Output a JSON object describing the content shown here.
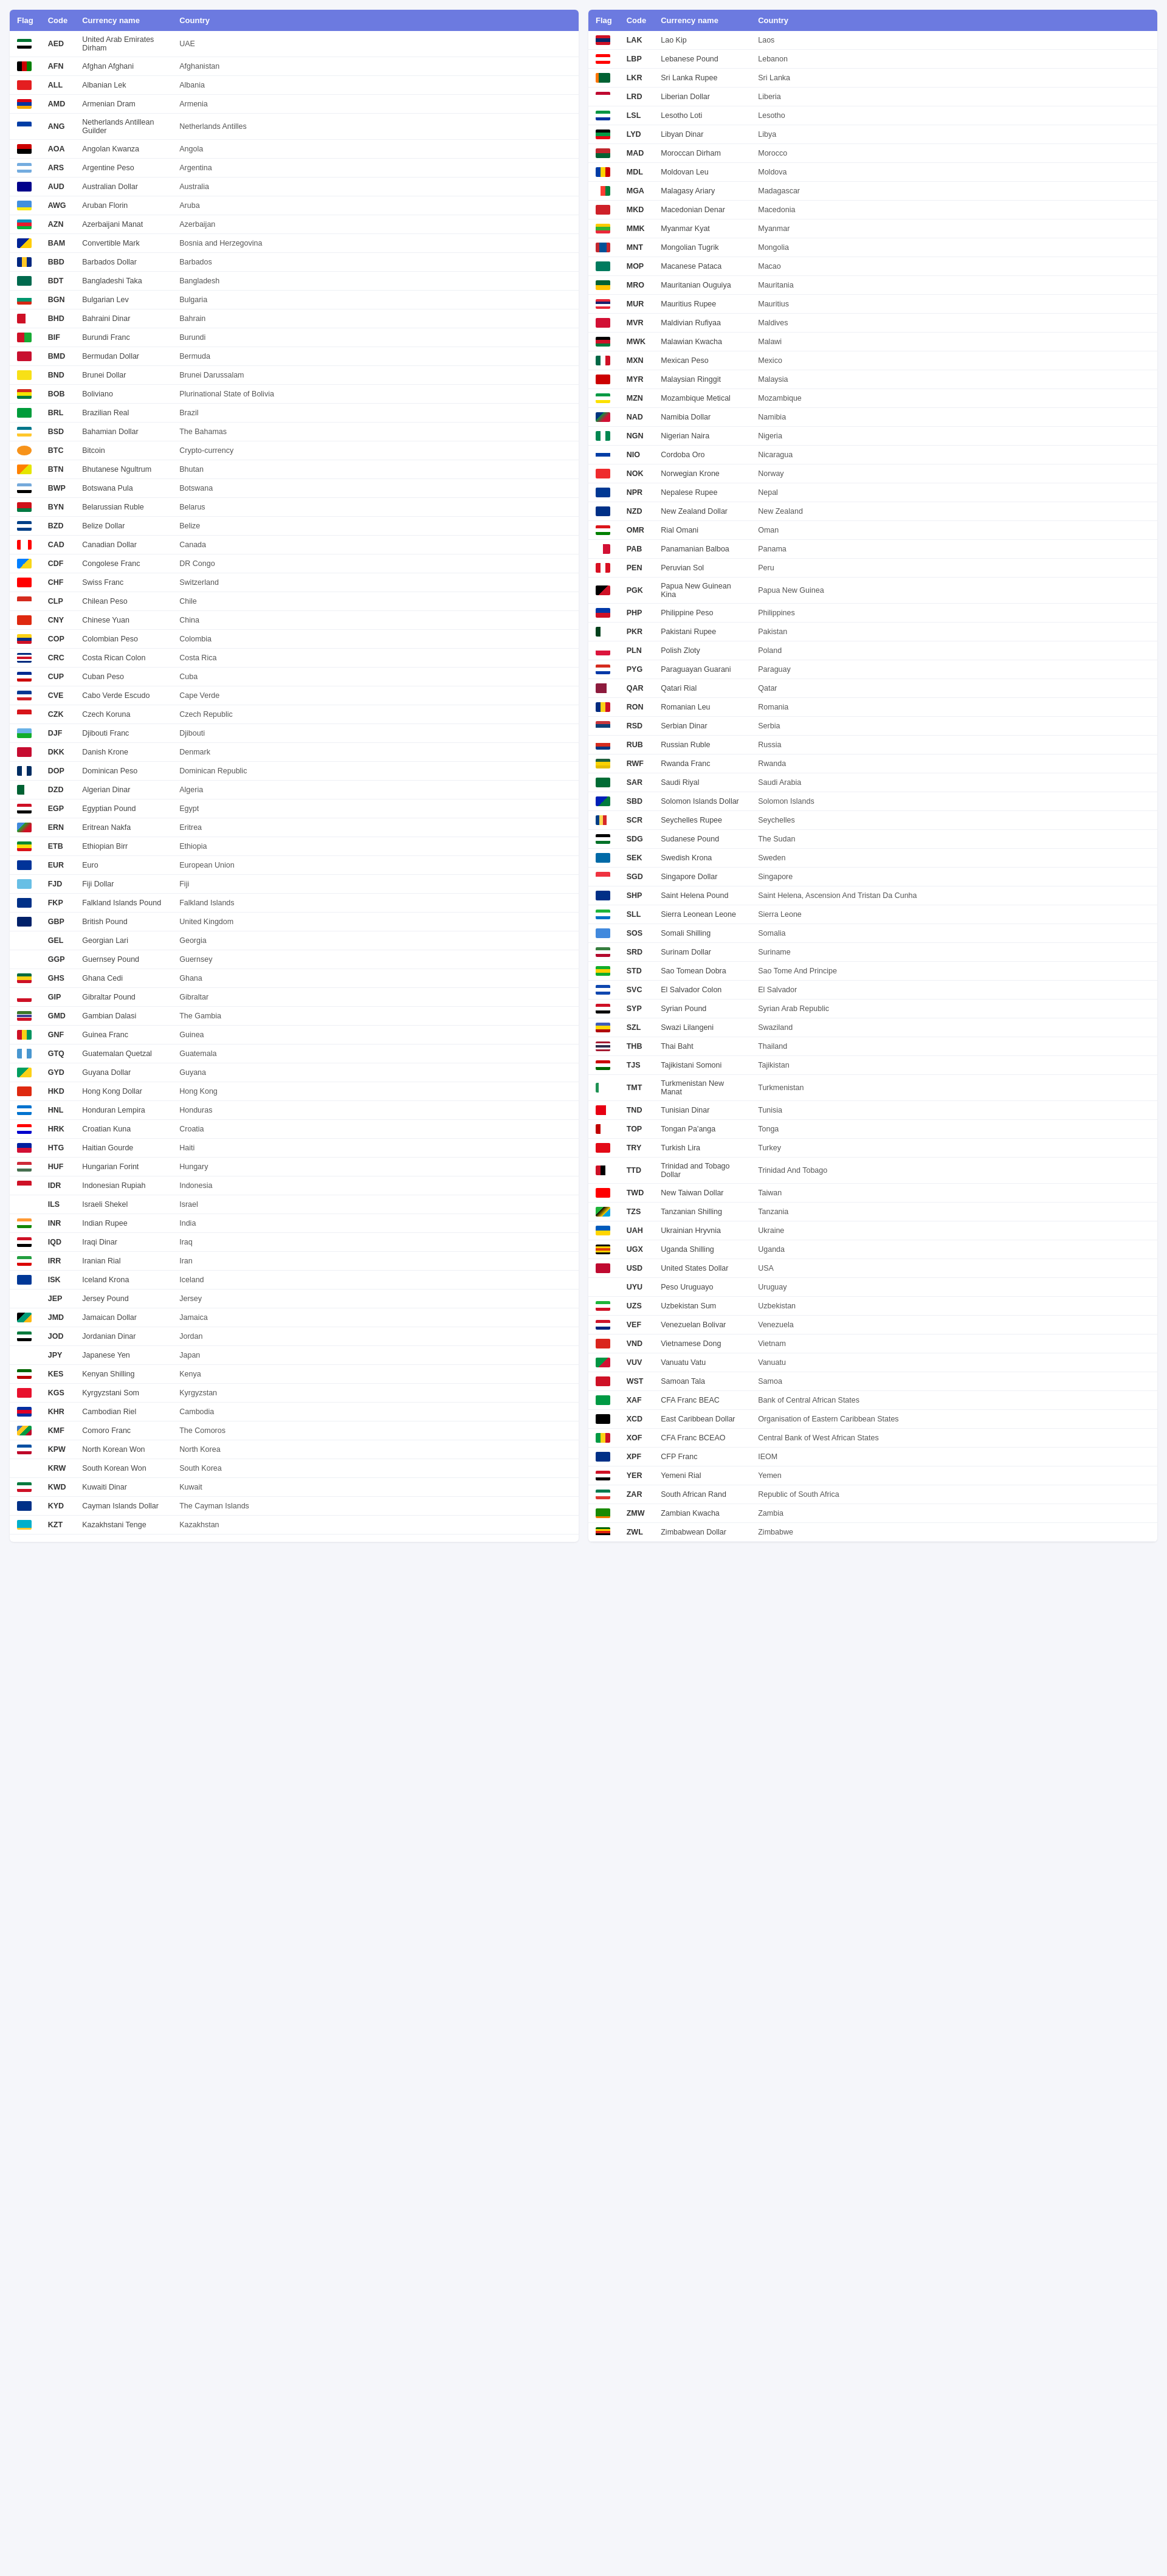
{
  "header": {
    "flag": "Flag",
    "code": "Code",
    "currency_name": "Currency name",
    "country": "Country"
  },
  "left_table": [
    {
      "code": "AED",
      "name": "United Arab Emirates Dirham",
      "country": "UAE",
      "flag": "ae"
    },
    {
      "code": "AFN",
      "name": "Afghan Afghani",
      "country": "Afghanistan",
      "flag": "af"
    },
    {
      "code": "ALL",
      "name": "Albanian Lek",
      "country": "Albania",
      "flag": "al"
    },
    {
      "code": "AMD",
      "name": "Armenian Dram",
      "country": "Armenia",
      "flag": "am"
    },
    {
      "code": "ANG",
      "name": "Netherlands Antillean Guilder",
      "country": "Netherlands Antilles",
      "flag": "an"
    },
    {
      "code": "AOA",
      "name": "Angolan Kwanza",
      "country": "Angola",
      "flag": "ao"
    },
    {
      "code": "ARS",
      "name": "Argentine Peso",
      "country": "Argentina",
      "flag": "ar"
    },
    {
      "code": "AUD",
      "name": "Australian Dollar",
      "country": "Australia",
      "flag": "au"
    },
    {
      "code": "AWG",
      "name": "Aruban Florin",
      "country": "Aruba",
      "flag": "aw"
    },
    {
      "code": "AZN",
      "name": "Azerbaijani Manat",
      "country": "Azerbaijan",
      "flag": "az"
    },
    {
      "code": "BAM",
      "name": "Convertible Mark",
      "country": "Bosnia and Herzegovina",
      "flag": "ba"
    },
    {
      "code": "BBD",
      "name": "Barbados Dollar",
      "country": "Barbados",
      "flag": "bb"
    },
    {
      "code": "BDT",
      "name": "Bangladeshi Taka",
      "country": "Bangladesh",
      "flag": "bd"
    },
    {
      "code": "BGN",
      "name": "Bulgarian Lev",
      "country": "Bulgaria",
      "flag": "bg"
    },
    {
      "code": "BHD",
      "name": "Bahraini Dinar",
      "country": "Bahrain",
      "flag": "bh"
    },
    {
      "code": "BIF",
      "name": "Burundi Franc",
      "country": "Burundi",
      "flag": "bi"
    },
    {
      "code": "BMD",
      "name": "Bermudan Dollar",
      "country": "Bermuda",
      "flag": "bm"
    },
    {
      "code": "BND",
      "name": "Brunei Dollar",
      "country": "Brunei Darussalam",
      "flag": "bn"
    },
    {
      "code": "BOB",
      "name": "Boliviano",
      "country": "Plurinational State of Bolivia",
      "flag": "bo"
    },
    {
      "code": "BRL",
      "name": "Brazilian Real",
      "country": "Brazil",
      "flag": "br"
    },
    {
      "code": "BSD",
      "name": "Bahamian Dollar",
      "country": "The Bahamas",
      "flag": "bs"
    },
    {
      "code": "BTC",
      "name": "Bitcoin",
      "country": "Crypto-currency",
      "flag": "btc"
    },
    {
      "code": "BTN",
      "name": "Bhutanese Ngultrum",
      "country": "Bhutan",
      "flag": "bt"
    },
    {
      "code": "BWP",
      "name": "Botswana Pula",
      "country": "Botswana",
      "flag": "bw"
    },
    {
      "code": "BYN",
      "name": "Belarussian Ruble",
      "country": "Belarus",
      "flag": "by"
    },
    {
      "code": "BZD",
      "name": "Belize Dollar",
      "country": "Belize",
      "flag": "bz"
    },
    {
      "code": "CAD",
      "name": "Canadian Dollar",
      "country": "Canada",
      "flag": "ca"
    },
    {
      "code": "CDF",
      "name": "Congolese Franc",
      "country": "DR Congo",
      "flag": "cd"
    },
    {
      "code": "CHF",
      "name": "Swiss Franc",
      "country": "Switzerland",
      "flag": "ch"
    },
    {
      "code": "CLP",
      "name": "Chilean Peso",
      "country": "Chile",
      "flag": "cl"
    },
    {
      "code": "CNY",
      "name": "Chinese Yuan",
      "country": "China",
      "flag": "cn"
    },
    {
      "code": "COP",
      "name": "Colombian Peso",
      "country": "Colombia",
      "flag": "co"
    },
    {
      "code": "CRC",
      "name": "Costa Rican Colon",
      "country": "Costa Rica",
      "flag": "cr"
    },
    {
      "code": "CUP",
      "name": "Cuban Peso",
      "country": "Cuba",
      "flag": "cu"
    },
    {
      "code": "CVE",
      "name": "Cabo Verde Escudo",
      "country": "Cape Verde",
      "flag": "cv"
    },
    {
      "code": "CZK",
      "name": "Czech Koruna",
      "country": "Czech Republic",
      "flag": "cz"
    },
    {
      "code": "DJF",
      "name": "Djibouti Franc",
      "country": "Djibouti",
      "flag": "dj"
    },
    {
      "code": "DKK",
      "name": "Danish Krone",
      "country": "Denmark",
      "flag": "dk"
    },
    {
      "code": "DOP",
      "name": "Dominican Peso",
      "country": "Dominican Republic",
      "flag": "do"
    },
    {
      "code": "DZD",
      "name": "Algerian Dinar",
      "country": "Algeria",
      "flag": "dz"
    },
    {
      "code": "EGP",
      "name": "Egyptian Pound",
      "country": "Egypt",
      "flag": "eg"
    },
    {
      "code": "ERN",
      "name": "Eritrean Nakfa",
      "country": "Eritrea",
      "flag": "er"
    },
    {
      "code": "ETB",
      "name": "Ethiopian Birr",
      "country": "Ethiopia",
      "flag": "et"
    },
    {
      "code": "EUR",
      "name": "Euro",
      "country": "European Union",
      "flag": "eu"
    },
    {
      "code": "FJD",
      "name": "Fiji Dollar",
      "country": "Fiji",
      "flag": "fj"
    },
    {
      "code": "FKP",
      "name": "Falkland Islands Pound",
      "country": "Falkland Islands",
      "flag": "fk"
    },
    {
      "code": "GBP",
      "name": "British Pound",
      "country": "United Kingdom",
      "flag": "gb"
    },
    {
      "code": "GEL",
      "name": "Georgian Lari",
      "country": "Georgia",
      "flag": "ge"
    },
    {
      "code": "GGP",
      "name": "Guernsey Pound",
      "country": "Guernsey",
      "flag": "gg"
    },
    {
      "code": "GHS",
      "name": "Ghana Cedi",
      "country": "Ghana",
      "flag": "gh"
    },
    {
      "code": "GIP",
      "name": "Gibraltar Pound",
      "country": "Gibraltar",
      "flag": "gi"
    },
    {
      "code": "GMD",
      "name": "Gambian Dalasi",
      "country": "The Gambia",
      "flag": "gm"
    },
    {
      "code": "GNF",
      "name": "Guinea Franc",
      "country": "Guinea",
      "flag": "gn"
    },
    {
      "code": "GTQ",
      "name": "Guatemalan Quetzal",
      "country": "Guatemala",
      "flag": "gt"
    },
    {
      "code": "GYD",
      "name": "Guyana Dollar",
      "country": "Guyana",
      "flag": "gy"
    },
    {
      "code": "HKD",
      "name": "Hong Kong Dollar",
      "country": "Hong Kong",
      "flag": "hk"
    },
    {
      "code": "HNL",
      "name": "Honduran Lempira",
      "country": "Honduras",
      "flag": "hn"
    },
    {
      "code": "HRK",
      "name": "Croatian Kuna",
      "country": "Croatia",
      "flag": "hr"
    },
    {
      "code": "HTG",
      "name": "Haitian Gourde",
      "country": "Haiti",
      "flag": "ht"
    },
    {
      "code": "HUF",
      "name": "Hungarian Forint",
      "country": "Hungary",
      "flag": "hu"
    },
    {
      "code": "IDR",
      "name": "Indonesian Rupiah",
      "country": "Indonesia",
      "flag": "id"
    },
    {
      "code": "ILS",
      "name": "Israeli Shekel",
      "country": "Israel",
      "flag": "il"
    },
    {
      "code": "INR",
      "name": "Indian Rupee",
      "country": "India",
      "flag": "in"
    },
    {
      "code": "IQD",
      "name": "Iraqi Dinar",
      "country": "Iraq",
      "flag": "iq"
    },
    {
      "code": "IRR",
      "name": "Iranian Rial",
      "country": "Iran",
      "flag": "ir"
    },
    {
      "code": "ISK",
      "name": "Iceland Krona",
      "country": "Iceland",
      "flag": "is"
    },
    {
      "code": "JEP",
      "name": "Jersey Pound",
      "country": "Jersey",
      "flag": "je"
    },
    {
      "code": "JMD",
      "name": "Jamaican Dollar",
      "country": "Jamaica",
      "flag": "jm"
    },
    {
      "code": "JOD",
      "name": "Jordanian Dinar",
      "country": "Jordan",
      "flag": "jo"
    },
    {
      "code": "JPY",
      "name": "Japanese Yen",
      "country": "Japan",
      "flag": "jp"
    },
    {
      "code": "KES",
      "name": "Kenyan Shilling",
      "country": "Kenya",
      "flag": "ke"
    },
    {
      "code": "KGS",
      "name": "Kyrgyzstani Som",
      "country": "Kyrgyzstan",
      "flag": "kg"
    },
    {
      "code": "KHR",
      "name": "Cambodian Riel",
      "country": "Cambodia",
      "flag": "kh"
    },
    {
      "code": "KMF",
      "name": "Comoro Franc",
      "country": "The Comoros",
      "flag": "km"
    },
    {
      "code": "KPW",
      "name": "North Korean Won",
      "country": "North Korea",
      "flag": "kp"
    },
    {
      "code": "KRW",
      "name": "South Korean Won",
      "country": "South Korea",
      "flag": "kr"
    },
    {
      "code": "KWD",
      "name": "Kuwaiti Dinar",
      "country": "Kuwait",
      "flag": "kw"
    },
    {
      "code": "KYD",
      "name": "Cayman Islands Dollar",
      "country": "The Cayman Islands",
      "flag": "ky"
    },
    {
      "code": "KZT",
      "name": "Kazakhstani Tenge",
      "country": "Kazakhstan",
      "flag": "kz"
    }
  ],
  "right_table": [
    {
      "code": "LAK",
      "name": "Lao Kip",
      "country": "Laos",
      "flag": "la"
    },
    {
      "code": "LBP",
      "name": "Lebanese Pound",
      "country": "Lebanon",
      "flag": "lb"
    },
    {
      "code": "LKR",
      "name": "Sri Lanka Rupee",
      "country": "Sri Lanka",
      "flag": "lk"
    },
    {
      "code": "LRD",
      "name": "Liberian Dollar",
      "country": "Liberia",
      "flag": "lr"
    },
    {
      "code": "LSL",
      "name": "Lesotho Loti",
      "country": "Lesotho",
      "flag": "ls"
    },
    {
      "code": "LYD",
      "name": "Libyan Dinar",
      "country": "Libya",
      "flag": "ly"
    },
    {
      "code": "MAD",
      "name": "Moroccan Dirham",
      "country": "Morocco",
      "flag": "ma"
    },
    {
      "code": "MDL",
      "name": "Moldovan Leu",
      "country": "Moldova",
      "flag": "md"
    },
    {
      "code": "MGA",
      "name": "Malagasy Ariary",
      "country": "Madagascar",
      "flag": "mg"
    },
    {
      "code": "MKD",
      "name": "Macedonian Denar",
      "country": "Macedonia",
      "flag": "mk"
    },
    {
      "code": "MMK",
      "name": "Myanmar Kyat",
      "country": "Myanmar",
      "flag": "mm"
    },
    {
      "code": "MNT",
      "name": "Mongolian Tugrik",
      "country": "Mongolia",
      "flag": "mn"
    },
    {
      "code": "MOP",
      "name": "Macanese Pataca",
      "country": "Macao",
      "flag": "mo"
    },
    {
      "code": "MRO",
      "name": "Mauritanian Ouguiya",
      "country": "Mauritania",
      "flag": "mr"
    },
    {
      "code": "MUR",
      "name": "Mauritius Rupee",
      "country": "Mauritius",
      "flag": "mu"
    },
    {
      "code": "MVR",
      "name": "Maldivian Rufiyaa",
      "country": "Maldives",
      "flag": "mv"
    },
    {
      "code": "MWK",
      "name": "Malawian Kwacha",
      "country": "Malawi",
      "flag": "mw"
    },
    {
      "code": "MXN",
      "name": "Mexican Peso",
      "country": "Mexico",
      "flag": "mx"
    },
    {
      "code": "MYR",
      "name": "Malaysian Ringgit",
      "country": "Malaysia",
      "flag": "my"
    },
    {
      "code": "MZN",
      "name": "Mozambique Metical",
      "country": "Mozambique",
      "flag": "mz"
    },
    {
      "code": "NAD",
      "name": "Namibia Dollar",
      "country": "Namibia",
      "flag": "na"
    },
    {
      "code": "NGN",
      "name": "Nigerian Naira",
      "country": "Nigeria",
      "flag": "ng"
    },
    {
      "code": "NIO",
      "name": "Cordoba Oro",
      "country": "Nicaragua",
      "flag": "ni"
    },
    {
      "code": "NOK",
      "name": "Norwegian Krone",
      "country": "Norway",
      "flag": "no"
    },
    {
      "code": "NPR",
      "name": "Nepalese Rupee",
      "country": "Nepal",
      "flag": "np"
    },
    {
      "code": "NZD",
      "name": "New Zealand Dollar",
      "country": "New Zealand",
      "flag": "nz"
    },
    {
      "code": "OMR",
      "name": "Rial Omani",
      "country": "Oman",
      "flag": "om"
    },
    {
      "code": "PAB",
      "name": "Panamanian Balboa",
      "country": "Panama",
      "flag": "pa"
    },
    {
      "code": "PEN",
      "name": "Peruvian Sol",
      "country": "Peru",
      "flag": "pe"
    },
    {
      "code": "PGK",
      "name": "Papua New Guinean Kina",
      "country": "Papua New Guinea",
      "flag": "pg"
    },
    {
      "code": "PHP",
      "name": "Philippine Peso",
      "country": "Philippines",
      "flag": "ph"
    },
    {
      "code": "PKR",
      "name": "Pakistani Rupee",
      "country": "Pakistan",
      "flag": "pk"
    },
    {
      "code": "PLN",
      "name": "Polish Zloty",
      "country": "Poland",
      "flag": "pl"
    },
    {
      "code": "PYG",
      "name": "Paraguayan Guarani",
      "country": "Paraguay",
      "flag": "py"
    },
    {
      "code": "QAR",
      "name": "Qatari Rial",
      "country": "Qatar",
      "flag": "qa"
    },
    {
      "code": "RON",
      "name": "Romanian Leu",
      "country": "Romania",
      "flag": "ro"
    },
    {
      "code": "RSD",
      "name": "Serbian Dinar",
      "country": "Serbia",
      "flag": "rs"
    },
    {
      "code": "RUB",
      "name": "Russian Ruble",
      "country": "Russia",
      "flag": "ru"
    },
    {
      "code": "RWF",
      "name": "Rwanda Franc",
      "country": "Rwanda",
      "flag": "rw"
    },
    {
      "code": "SAR",
      "name": "Saudi Riyal",
      "country": "Saudi Arabia",
      "flag": "sa"
    },
    {
      "code": "SBD",
      "name": "Solomon Islands Dollar",
      "country": "Solomon Islands",
      "flag": "sb"
    },
    {
      "code": "SCR",
      "name": "Seychelles Rupee",
      "country": "Seychelles",
      "flag": "sc"
    },
    {
      "code": "SDG",
      "name": "Sudanese Pound",
      "country": "The Sudan",
      "flag": "sd"
    },
    {
      "code": "SEK",
      "name": "Swedish Krona",
      "country": "Sweden",
      "flag": "se"
    },
    {
      "code": "SGD",
      "name": "Singapore Dollar",
      "country": "Singapore",
      "flag": "sg"
    },
    {
      "code": "SHP",
      "name": "Saint Helena Pound",
      "country": "Saint Helena, Ascension And Tristan Da Cunha",
      "flag": "sh"
    },
    {
      "code": "SLL",
      "name": "Sierra Leonean Leone",
      "country": "Sierra Leone",
      "flag": "sl"
    },
    {
      "code": "SOS",
      "name": "Somali Shilling",
      "country": "Somalia",
      "flag": "so"
    },
    {
      "code": "SRD",
      "name": "Surinam Dollar",
      "country": "Suriname",
      "flag": "sr"
    },
    {
      "code": "STD",
      "name": "Sao Tomean Dobra",
      "country": "Sao Tome And Principe",
      "flag": "st"
    },
    {
      "code": "SVC",
      "name": "El Salvador Colon",
      "country": "El Salvador",
      "flag": "sv"
    },
    {
      "code": "SYP",
      "name": "Syrian Pound",
      "country": "Syrian Arab Republic",
      "flag": "sy"
    },
    {
      "code": "SZL",
      "name": "Swazi Lilangeni",
      "country": "Swaziland",
      "flag": "sz"
    },
    {
      "code": "THB",
      "name": "Thai Baht",
      "country": "Thailand",
      "flag": "th"
    },
    {
      "code": "TJS",
      "name": "Tajikistani Somoni",
      "country": "Tajikistan",
      "flag": "tj"
    },
    {
      "code": "TMT",
      "name": "Turkmenistan New Manat",
      "country": "Turkmenistan",
      "flag": "tm"
    },
    {
      "code": "TND",
      "name": "Tunisian Dinar",
      "country": "Tunisia",
      "flag": "tn"
    },
    {
      "code": "TOP",
      "name": "Tongan Pa'anga",
      "country": "Tonga",
      "flag": "to"
    },
    {
      "code": "TRY",
      "name": "Turkish Lira",
      "country": "Turkey",
      "flag": "tr"
    },
    {
      "code": "TTD",
      "name": "Trinidad and Tobago Dollar",
      "country": "Trinidad And Tobago",
      "flag": "tt"
    },
    {
      "code": "TWD",
      "name": "New Taiwan Dollar",
      "country": "Taiwan",
      "flag": "tw"
    },
    {
      "code": "TZS",
      "name": "Tanzanian Shilling",
      "country": "Tanzania",
      "flag": "tz"
    },
    {
      "code": "UAH",
      "name": "Ukrainian Hryvnia",
      "country": "Ukraine",
      "flag": "ua"
    },
    {
      "code": "UGX",
      "name": "Uganda Shilling",
      "country": "Uganda",
      "flag": "ug"
    },
    {
      "code": "USD",
      "name": "United States Dollar",
      "country": "USA",
      "flag": "us"
    },
    {
      "code": "UYU",
      "name": "Peso Uruguayo",
      "country": "Uruguay",
      "flag": "uy"
    },
    {
      "code": "UZS",
      "name": "Uzbekistan Sum",
      "country": "Uzbekistan",
      "flag": "uz"
    },
    {
      "code": "VEF",
      "name": "Venezuelan Bolivar",
      "country": "Venezuela",
      "flag": "ve"
    },
    {
      "code": "VND",
      "name": "Vietnamese Dong",
      "country": "Vietnam",
      "flag": "vn"
    },
    {
      "code": "VUV",
      "name": "Vanuatu Vatu",
      "country": "Vanuatu",
      "flag": "vu"
    },
    {
      "code": "WST",
      "name": "Samoan Tala",
      "country": "Samoa",
      "flag": "ws"
    },
    {
      "code": "XAF",
      "name": "CFA Franc BEAC",
      "country": "Bank of Central African States",
      "flag": "xaf"
    },
    {
      "code": "XCD",
      "name": "East Caribbean Dollar",
      "country": "Organisation of Eastern Caribbean States",
      "flag": "xcd"
    },
    {
      "code": "XOF",
      "name": "CFA Franc BCEAO",
      "country": "Central Bank of West African States",
      "flag": "xof"
    },
    {
      "code": "XPF",
      "name": "CFP Franc",
      "country": "IEOM",
      "flag": "xpf"
    },
    {
      "code": "YER",
      "name": "Yemeni Rial",
      "country": "Yemen",
      "flag": "ye"
    },
    {
      "code": "ZAR",
      "name": "South African Rand",
      "country": "Republic of South Africa",
      "flag": "za"
    },
    {
      "code": "ZMW",
      "name": "Zambian Kwacha",
      "country": "Zambia",
      "flag": "zm"
    },
    {
      "code": "ZWL",
      "name": "Zimbabwean Dollar",
      "country": "Zimbabwe",
      "flag": "zw"
    }
  ]
}
